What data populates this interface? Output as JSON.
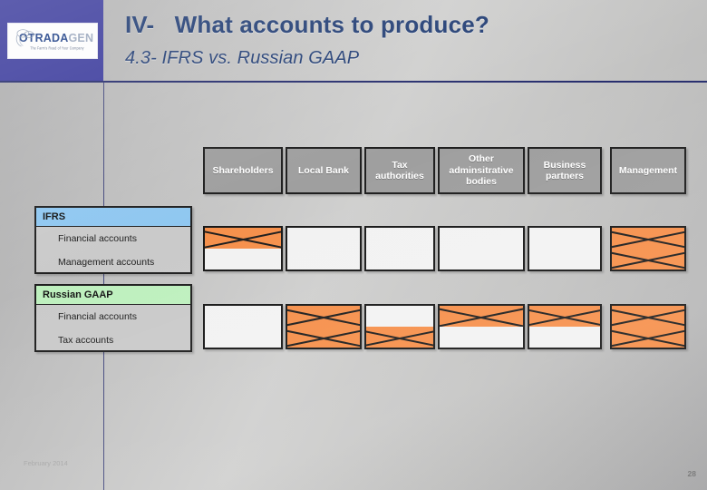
{
  "slide": {
    "title": "IV-   What accounts to produce?",
    "subtitle": "4.3- IFRS vs. Russian GAAP",
    "footer_date": "February 2014",
    "page_number": "28",
    "accent_navy": "#1f3b72",
    "rule_navy": "#232a6b",
    "logo_panel_color": "#3a3a9c",
    "orange": "#f68e48",
    "header_gray": "#9d9d9d",
    "ifrs_band": "#8dc6f0",
    "rgaap_band": "#bdf0bd"
  },
  "logo": {
    "word_primary": "OTRADA",
    "word_secondary": "GEN",
    "tagline": "The Farm's Road of Your Company"
  },
  "matrix": {
    "columns": [
      {
        "label": "Shareholders"
      },
      {
        "label": "Local Bank"
      },
      {
        "label": "Tax authorities"
      },
      {
        "label": "Other adminsitrative bodies"
      },
      {
        "label": "Business partners"
      },
      {
        "label": "Management"
      }
    ],
    "row_groups": [
      {
        "standard": "IFRS",
        "rows": [
          {
            "label": "Financial accounts"
          },
          {
            "label": "Management accounts"
          }
        ],
        "cells": [
          {
            "top": "orange-x",
            "bottom": "blank"
          },
          {
            "top": "blank",
            "bottom": "blank"
          },
          {
            "top": "blank",
            "bottom": "blank"
          },
          {
            "top": "blank",
            "bottom": "blank"
          },
          {
            "top": "blank",
            "bottom": "blank"
          },
          {
            "top": "orange-x",
            "bottom": "orange-x"
          }
        ]
      },
      {
        "standard": "Russian GAAP",
        "rows": [
          {
            "label": "Financial accounts"
          },
          {
            "label": "Tax accounts"
          }
        ],
        "cells": [
          {
            "top": "blank",
            "bottom": "blank"
          },
          {
            "top": "orange-x",
            "bottom": "orange-x"
          },
          {
            "top": "blank",
            "bottom": "orange-x"
          },
          {
            "top": "orange-x",
            "bottom": "blank"
          },
          {
            "top": "orange-x",
            "bottom": "blank"
          },
          {
            "top": "orange-x",
            "bottom": "orange-x"
          }
        ]
      }
    ]
  }
}
